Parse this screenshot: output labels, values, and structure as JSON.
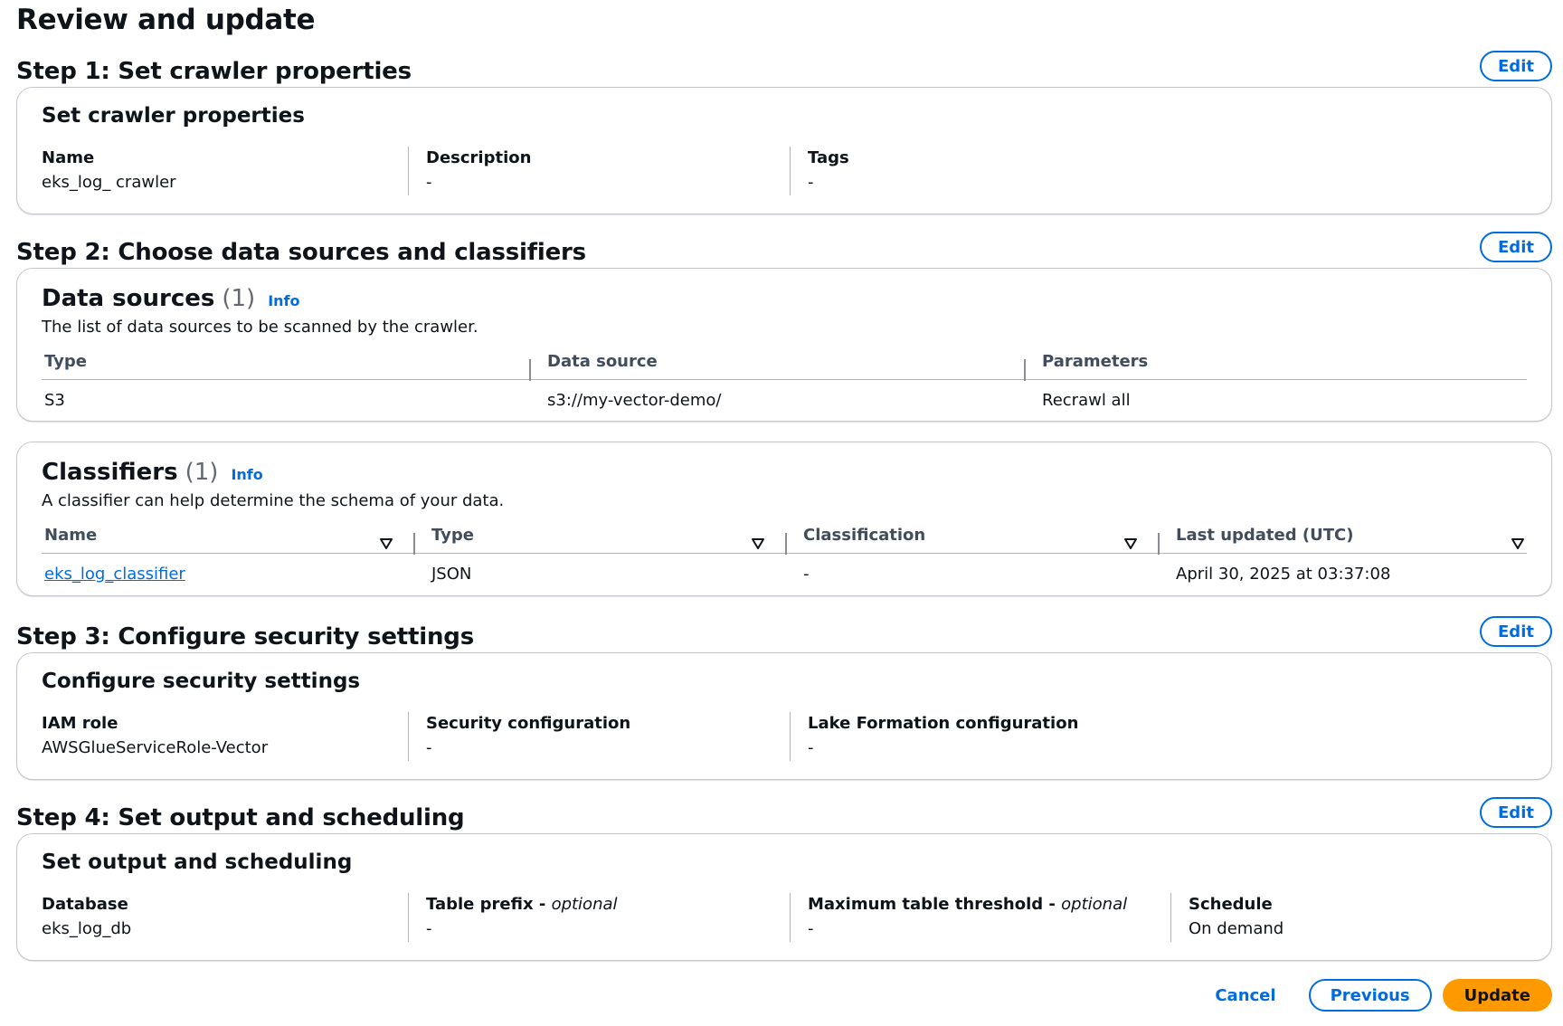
{
  "page": {
    "title": "Review and update"
  },
  "step1": {
    "title": "Step 1: Set crawler properties",
    "edit_label": "Edit",
    "card_title": "Set crawler properties",
    "fields": [
      {
        "label": "Name",
        "value": "eks_log_ crawler"
      },
      {
        "label": "Description",
        "value": "-"
      },
      {
        "label": "Tags",
        "value": "-"
      }
    ]
  },
  "step2": {
    "title": "Step 2: Choose data sources and classifiers",
    "edit_label": "Edit",
    "data_sources": {
      "title": "Data sources",
      "count": "(1)",
      "info": "Info",
      "description": "The list of data sources to be scanned by the crawler.",
      "columns": [
        "Type",
        "Data source",
        "Parameters"
      ],
      "rows": [
        [
          "S3",
          "s3://my-vector-demo/",
          "Recrawl all"
        ]
      ]
    },
    "classifiers": {
      "title": "Classifiers",
      "count": "(1)",
      "info": "Info",
      "description": "A classifier can help determine the schema of your data.",
      "columns": [
        "Name",
        "Type",
        "Classification",
        "Last updated (UTC)"
      ],
      "rows": [
        [
          "eks_log_classifier",
          "JSON",
          "-",
          "April 30, 2025 at 03:37:08"
        ]
      ]
    }
  },
  "step3": {
    "title": "Step 3: Configure security settings",
    "edit_label": "Edit",
    "card_title": "Configure security settings",
    "fields": [
      {
        "label": "IAM role",
        "value": "AWSGlueServiceRole-Vector"
      },
      {
        "label": "Security configuration",
        "value": "-"
      },
      {
        "label": "Lake Formation configuration",
        "value": "-"
      }
    ]
  },
  "step4": {
    "title": "Step 4: Set output and scheduling",
    "edit_label": "Edit",
    "card_title": "Set output and scheduling",
    "fields": [
      {
        "label": "Database",
        "optional": "",
        "value": "eks_log_db"
      },
      {
        "label": "Table prefix - ",
        "optional": "optional",
        "value": "-"
      },
      {
        "label": "Maximum table threshold - ",
        "optional": "optional",
        "value": "-"
      },
      {
        "label": "Schedule",
        "optional": "",
        "value": "On demand"
      }
    ]
  },
  "footer": {
    "cancel": "Cancel",
    "previous": "Previous",
    "update": "Update"
  },
  "colors": {
    "link": "#006ce0",
    "primary_button": "#ff9900"
  },
  "icons": {
    "sort": "caret-down-filter-icon"
  }
}
